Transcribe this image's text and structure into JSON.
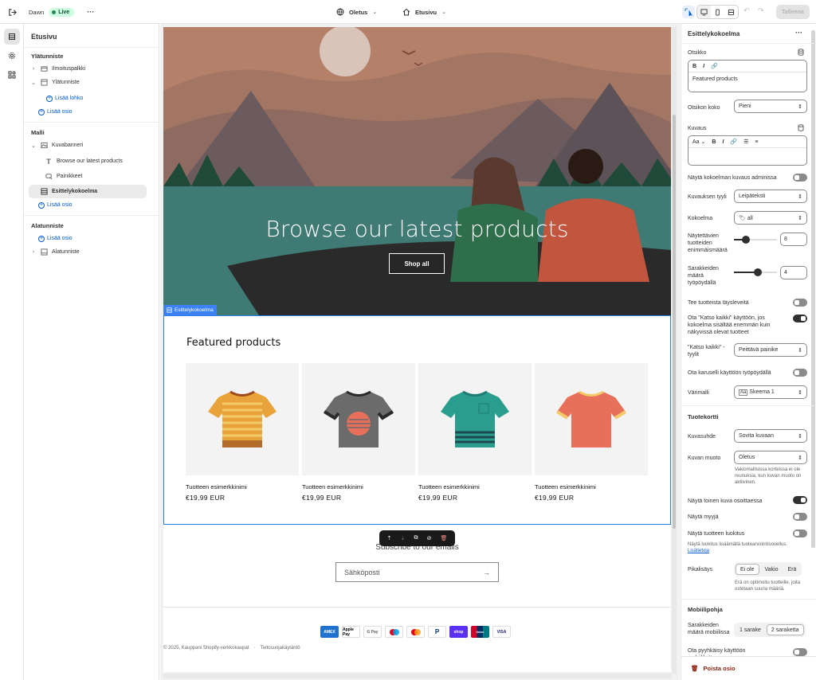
{
  "topbar": {
    "store_name": "Dawn",
    "live_label": "Live",
    "more": "···",
    "theme_select": "Oletus",
    "page_select": "Etusivu",
    "save_label": "Tallenna"
  },
  "left": {
    "title": "Etusivu",
    "header_section": "Ylätunniste",
    "announcement": "Ilmoituspalkki",
    "header": "Ylätunniste",
    "add_block": "Lisää lohko",
    "add_section": "Lisää osio",
    "template_section": "Malli",
    "image_banner": "Kuvabanneri",
    "banner_heading": "Browse our latest products",
    "buttons": "Painikkeet",
    "featured": "Esittelykokoelma",
    "add_section2": "Lisää osio",
    "footer_section": "Alatunniste",
    "add_section3": "Lisää osio",
    "footer": "Alatunniste"
  },
  "preview": {
    "hero_title": "Browse our latest products",
    "hero_button": "Shop all",
    "section_tag": "Esittelykokoelma",
    "featured_heading": "Featured products",
    "products": [
      {
        "name": "Tuotteen esimerkkinimi",
        "price": "€19,99 EUR",
        "color": "#e8a33a"
      },
      {
        "name": "Tuotteen esimerkkinimi",
        "price": "€19,99 EUR",
        "color": "#6b6b6b"
      },
      {
        "name": "Tuotteen esimerkkinimi",
        "price": "€19,99 EUR",
        "color": "#2a9d8f"
      },
      {
        "name": "Tuotteen esimerkkinimi",
        "price": "€19,99 EUR",
        "color": "#e8705a"
      }
    ],
    "subscribe": "Subscribe to our emails",
    "email_placeholder": "Sähköposti",
    "payments": [
      "AMEX",
      "Apple Pay",
      "G Pay",
      "Maestro",
      "MC",
      "PayPal",
      "shop",
      "UnionPay",
      "VISA"
    ],
    "copyright": "© 2025, Kauppani Shopify-verkkokaupat",
    "privacy": "Tietosuojakäytäntö"
  },
  "right": {
    "title": "Esittelykokoelma",
    "heading_label": "Otsikko",
    "heading_value": "Featured products",
    "heading_size_label": "Otsikon koko",
    "heading_size_value": "Pieni",
    "description_label": "Kuvaus",
    "show_desc_admin": "Näytä kokoelman kuvaus adminissa",
    "desc_style_label": "Kuvauksen tyyli",
    "desc_style_value": "Leipäteksti",
    "collection_label": "Kokoelma",
    "collection_value": "all",
    "max_products_label": "Näytettävien tuotteiden enimmäismäärä",
    "max_products_value": "8",
    "max_products_fraction": 0.28,
    "columns_label": "Sarakkeiden määrä työpöydällä",
    "columns_value": "4",
    "columns_fraction": 0.55,
    "full_width": "Tee tuotteista täysleveitä",
    "view_all": "Ota \"Katso kaikki\" käyttöön, jos kokoelma sisältää enemmän kuin näkyvissä olevat tuotteet",
    "view_all_style_label": "\"Katso kaikki\" -tyylit",
    "view_all_style_value": "Peittävä painike",
    "carousel": "Ota karuselli käyttöön työpöydällä",
    "color_scheme_label": "Värimalli",
    "color_scheme_value": "Skeema 1",
    "product_card": "Tuotekortti",
    "image_ratio_label": "Kuvasuhde",
    "image_ratio_value": "Sovita kuvaan",
    "image_shape_label": "Kuvan muoto",
    "image_shape_value": "Oletus",
    "image_shape_help": "Vakiomallisissa korteissa ei ole reunuksia, kun kuvan muoto on aktiivinen.",
    "second_image": "Näytä toinen kuva osoittaessa",
    "show_vendor": "Näytä myyjä",
    "show_rating": "Näytä tuotteen luokitus",
    "rating_help": "Näytä luokitus lisäämällä tuotearviointisovellus.",
    "learn_more": "Lisätietoja",
    "quick_add_label": "Pikalisäys",
    "quick_add_options": [
      "Ei ole",
      "Vakio",
      "Erä"
    ],
    "quick_add_help": "Erä on optimoitu tuotteille, joita ostetaan suuria määriä.",
    "mobile_layout": "Mobiilipohja",
    "mobile_cols_label": "Sarakkeiden määrä mobiilissa",
    "mobile_cols_options": [
      "1 sarake",
      "2 saraketta"
    ],
    "mobile_swipe": "Ota pyyhkäisy käyttöön mobiililaitteessa",
    "delete_label": "Poista osio"
  }
}
